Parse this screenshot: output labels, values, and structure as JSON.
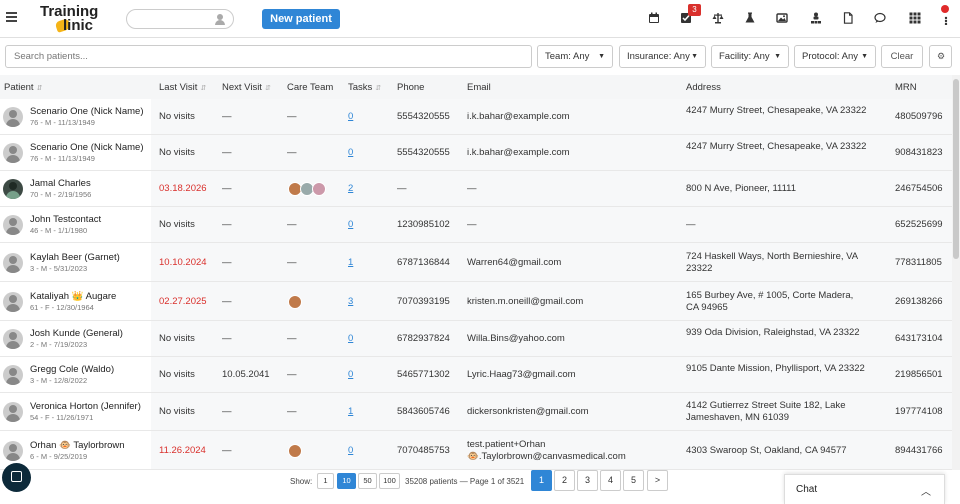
{
  "header": {
    "logo_line1": "Training",
    "logo_line2": "linic",
    "new_patient_label": "New patient",
    "tasks_badge": "3",
    "icons": [
      "calendar-icon",
      "tasks-icon",
      "scale-icon",
      "flask-icon",
      "image-icon",
      "org-chart-icon",
      "document-icon",
      "chat-bubble-icon",
      "apps-grid-icon",
      "kebab-menu-icon"
    ]
  },
  "filters": {
    "search_placeholder": "Search patients...",
    "team": "Team: Any",
    "insurance": "Insurance: Any",
    "facility": "Facility: Any",
    "protocol": "Protocol: Any",
    "clear_label": "Clear"
  },
  "table": {
    "columns": {
      "patient": "Patient",
      "last_visit": "Last Visit",
      "next_visit": "Next Visit",
      "care_team": "Care Team",
      "tasks": "Tasks",
      "phone": "Phone",
      "email": "Email",
      "address": "Address",
      "mrn": "MRN"
    },
    "rows": [
      {
        "name": "Scenario One (Nick Name)",
        "sub": "76 - M - 11/13/1949",
        "last_visit": "No visits",
        "next_visit": "—",
        "care_team": "—",
        "tasks": "0",
        "phone": "5554320555",
        "email": "i.k.bahar@example.com",
        "address": "4247 Murry Street, Chesapeake, VA 23322",
        "mrn": "480509796"
      },
      {
        "name": "Scenario One (Nick Name)",
        "sub": "76 - M - 11/13/1949",
        "last_visit": "No visits",
        "next_visit": "—",
        "care_team": "—",
        "tasks": "0",
        "phone": "5554320555",
        "email": "i.k.bahar@example.com",
        "address": "4247 Murry Street, Chesapeake, VA 23322",
        "mrn": "908431823"
      },
      {
        "name": "Jamal Charles",
        "sub": "70 - M - 2/19/1956",
        "last_visit": "03.18.2026",
        "next_visit": "—",
        "care_team": "",
        "tasks": "2",
        "phone": "—",
        "email": "—",
        "address": "800 N Ave, Pioneer, 11111",
        "mrn": "246754506"
      },
      {
        "name": "John Testcontact",
        "sub": "46 - M - 1/1/1980",
        "last_visit": "No visits",
        "next_visit": "—",
        "care_team": "—",
        "tasks": "0",
        "phone": "1230985102",
        "email": "—",
        "address": "—",
        "mrn": "652525699"
      },
      {
        "name": "Kaylah Beer (Garnet)",
        "sub": "3 - M - 5/31/2023",
        "last_visit": "10.10.2024",
        "next_visit": "—",
        "care_team": "—",
        "tasks": "1",
        "phone": "6787136844",
        "email": "Warren64@gmail.com",
        "address": "724 Haskell Ways, North Bernieshire, VA 23322",
        "mrn": "778311805"
      },
      {
        "name": "Kataliyah 👑 Augare",
        "sub": "61 - F - 12/30/1964",
        "last_visit": "02.27.2025",
        "next_visit": "—",
        "care_team": "",
        "tasks": "3",
        "phone": "7070393195",
        "email": "kristen.m.oneill@gmail.com",
        "address": "165 Burbey Ave, # 1005, Corte Madera, CA 94965",
        "mrn": "269138266"
      },
      {
        "name": "Josh Kunde (General)",
        "sub": "2 - M - 7/19/2023",
        "last_visit": "No visits",
        "next_visit": "—",
        "care_team": "—",
        "tasks": "0",
        "phone": "6782937824",
        "email": "Willa.Bins@yahoo.com",
        "address": "939 Oda Division, Raleighstad, VA 23322",
        "mrn": "643173104"
      },
      {
        "name": "Gregg Cole (Waldo)",
        "sub": "3 - M - 12/8/2022",
        "last_visit": "No visits",
        "next_visit": "10.05.2041",
        "care_team": "—",
        "tasks": "0",
        "phone": "5465771302",
        "email": "Lyric.Haag73@gmail.com",
        "address": "9105 Dante Mission, Phyllisport, VA 23322",
        "mrn": "219856501"
      },
      {
        "name": "Veronica Horton (Jennifer)",
        "sub": "54 - F - 11/26/1971",
        "last_visit": "No visits",
        "next_visit": "—",
        "care_team": "—",
        "tasks": "1",
        "phone": "5843605746",
        "email": "dickersonkristen@gmail.com",
        "address": "4142 Gutierrez Street Suite 182, Lake Jameshaven, MN 61039",
        "mrn": "197774108"
      },
      {
        "name": "Orhan 🐵 Taylorbrown",
        "sub": "6 - M - 9/25/2019",
        "last_visit": "11.26.2024",
        "next_visit": "—",
        "care_team": "",
        "tasks": "0",
        "phone": "7070485753",
        "email": "test.patient+Orhan 🐵.Taylorbrown@canvasmedical.com",
        "address": "4303 Swaroop St, Oakland, CA 94577",
        "mrn": "894431766"
      }
    ]
  },
  "pager": {
    "show_label": "Show:",
    "sizes": [
      "1",
      "10",
      "50",
      "100"
    ],
    "active_size": "10",
    "info": "35208 patients — Page 1 of 3521",
    "pages": [
      "1",
      "2",
      "3",
      "4",
      "5"
    ],
    "next": ">"
  },
  "chat": {
    "label": "Chat"
  },
  "colors": {
    "accent": "#2f86d6",
    "alert": "#d9302c",
    "logo_blob": "#f5b417"
  }
}
